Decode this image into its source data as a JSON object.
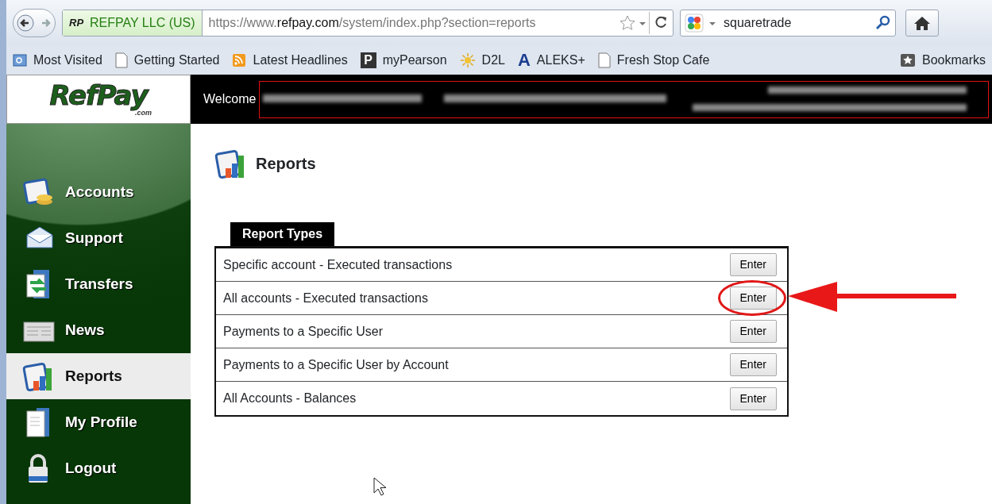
{
  "browser": {
    "identity_logo": "RP",
    "identity": "REFPAY LLC (US)",
    "url_prefix": "https://www.",
    "url_domain": "refpay.com",
    "url_path": "/system/index.php?section=reports",
    "search": "squaretrade",
    "bookmarks": [
      {
        "label": "Most Visited",
        "kind": "places"
      },
      {
        "label": "Getting Started",
        "kind": "page"
      },
      {
        "label": "Latest Headlines",
        "kind": "rss"
      },
      {
        "label": "myPearson",
        "kind": "letter",
        "glyph": "P"
      },
      {
        "label": "D2L",
        "kind": "sun"
      },
      {
        "label": "ALEKS+",
        "kind": "letter-blue",
        "glyph": "A"
      },
      {
        "label": "Fresh Stop Cafe",
        "kind": "page"
      }
    ],
    "bookmarks_menu": "Bookmarks"
  },
  "header": {
    "logo": "RefPay",
    "logo_suffix": ".com",
    "welcome": "Welcome"
  },
  "sidebar": {
    "items": [
      {
        "label": "Accounts",
        "selected": false
      },
      {
        "label": "Support",
        "selected": false
      },
      {
        "label": "Transfers",
        "selected": false
      },
      {
        "label": "News",
        "selected": false
      },
      {
        "label": "Reports",
        "selected": true
      },
      {
        "label": "My Profile",
        "selected": false
      },
      {
        "label": "Logout",
        "selected": false
      }
    ]
  },
  "page": {
    "title": "Reports",
    "tab": "Report Types",
    "rows": [
      {
        "label": "Specific account - Executed transactions",
        "button": "Enter",
        "circled": false
      },
      {
        "label": "All accounts - Executed transactions",
        "button": "Enter",
        "circled": true
      },
      {
        "label": "Payments to a Specific User",
        "button": "Enter",
        "circled": false
      },
      {
        "label": "Payments to a Specific User by Account",
        "button": "Enter",
        "circled": false
      },
      {
        "label": "All Accounts - Balances",
        "button": "Enter",
        "circled": false
      }
    ]
  }
}
